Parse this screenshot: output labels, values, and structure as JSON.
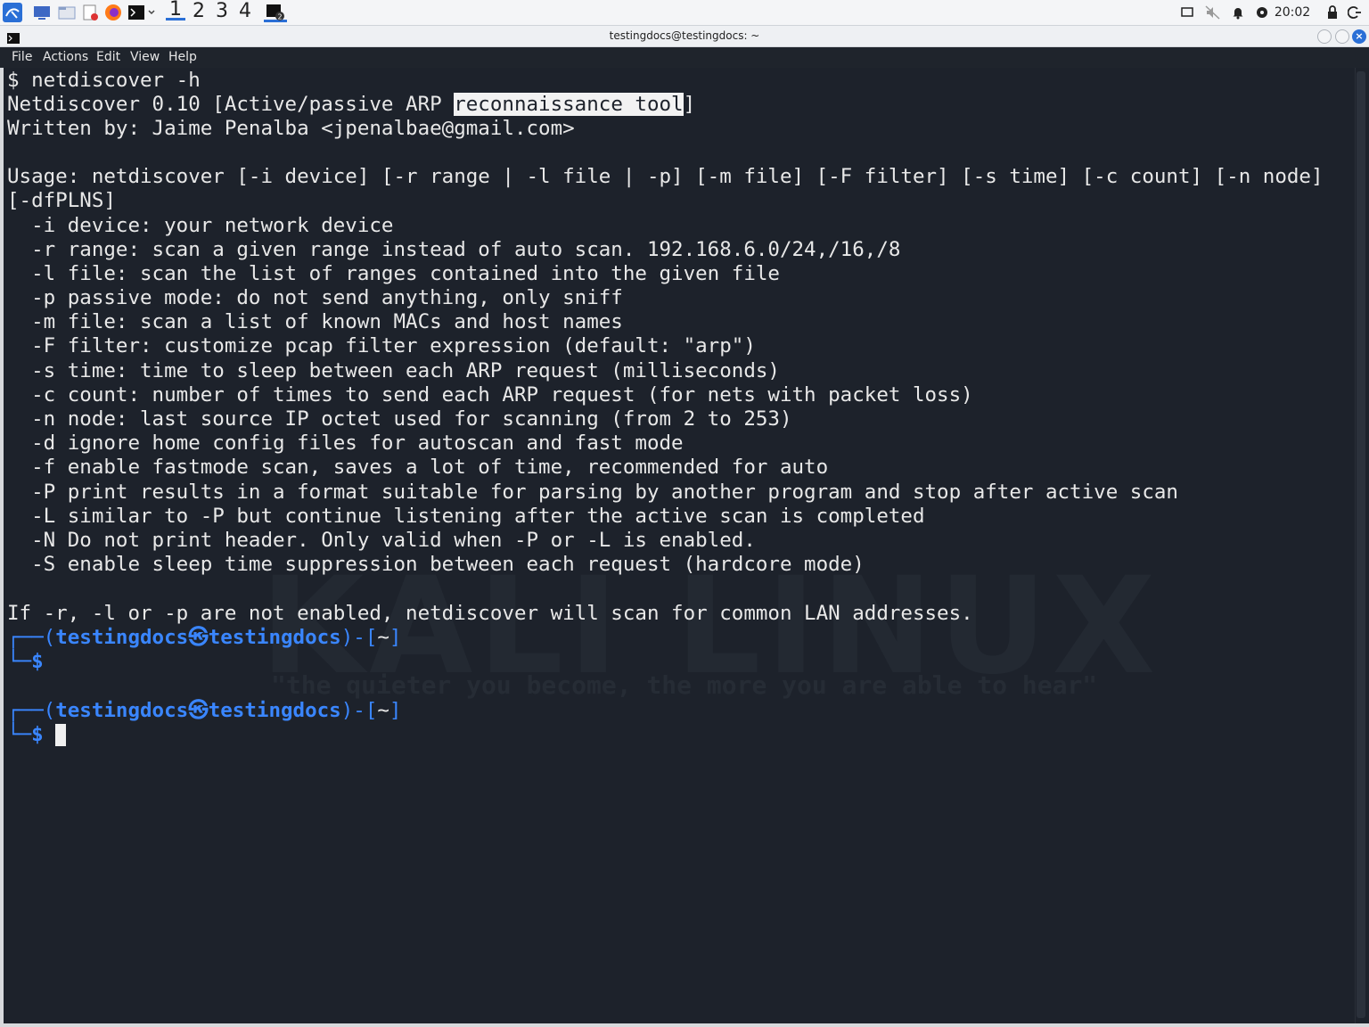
{
  "panel": {
    "workspaces": [
      "1",
      "2",
      "3",
      "4"
    ],
    "badge": "2",
    "clock": "20:02"
  },
  "window": {
    "title": "testingdocs@testingdocs: ~",
    "close": "×"
  },
  "menu": [
    "File",
    "Actions",
    "Edit",
    "View",
    "Help"
  ],
  "terminal": {
    "l0": "$ netdiscover -h",
    "l1a": "Netdiscover 0.10 [Active/passive ARP ",
    "l1b": "reconnaissance tool",
    "l1c": "]",
    "l2": "Written by: Jaime Penalba <jpenalbae@gmail.com>",
    "l4": "Usage: netdiscover [-i device] [-r range | -l file | -p] [-m file] [-F filter] [-s time] [-c count] [-n node]",
    "l5": "[-dfPLNS]",
    "l6": "  -i device: your network device",
    "l7": "  -r range: scan a given range instead of auto scan. 192.168.6.0/24,/16,/8",
    "l8": "  -l file: scan the list of ranges contained into the given file",
    "l9": "  -p passive mode: do not send anything, only sniff",
    "l10": "  -m file: scan a list of known MACs and host names",
    "l11": "  -F filter: customize pcap filter expression (default: \"arp\")",
    "l12": "  -s time: time to sleep between each ARP request (milliseconds)",
    "l13": "  -c count: number of times to send each ARP request (for nets with packet loss)",
    "l14": "  -n node: last source IP octet used for scanning (from 2 to 253)",
    "l15": "  -d ignore home config files for autoscan and fast mode",
    "l16": "  -f enable fastmode scan, saves a lot of time, recommended for auto",
    "l17": "  -P print results in a format suitable for parsing by another program and stop after active scan",
    "l18": "  -L similar to -P but continue listening after the active scan is completed",
    "l19": "  -N Do not print header. Only valid when -P or -L is enabled.",
    "l20": "  -S enable sleep time suppression between each request (hardcore mode)",
    "l22": "If -r, -l or -p are not enabled, netdiscover will scan for common LAN addresses.",
    "prompt_user": "testingdocs",
    "prompt_sep": "㉿",
    "prompt_host": "testingdocs",
    "prompt_dir": "~",
    "prompt_dollar": "$"
  },
  "watermark": {
    "logo": "KALI LINUX",
    "tagline": "\"the quieter you become, the more you are able to hear\""
  }
}
